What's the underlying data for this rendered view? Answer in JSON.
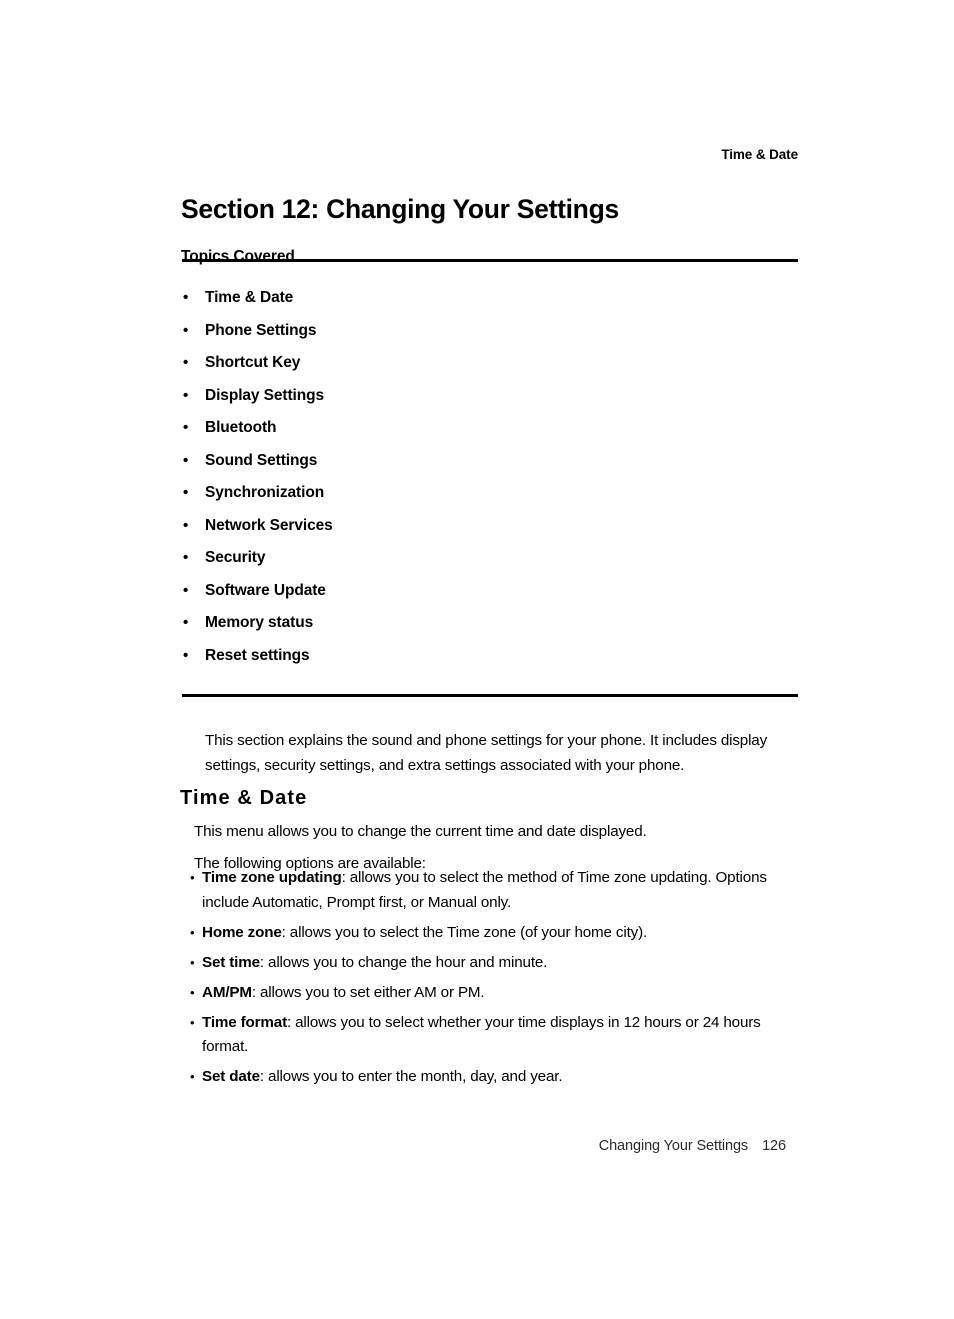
{
  "running_header": "Time & Date",
  "section_title": "Section 12: Changing Your Settings",
  "topics_label": "Topics Covered",
  "bullet_glyph": "•",
  "topics": [
    {
      "label": "Time & Date"
    },
    {
      "label": "Phone Settings"
    },
    {
      "label": "Shortcut Key"
    },
    {
      "label": "Display Settings"
    },
    {
      "label": "Bluetooth"
    },
    {
      "label": "Sound Settings"
    },
    {
      "label": "Synchronization"
    },
    {
      "label": "Network Services"
    },
    {
      "label": "Security"
    },
    {
      "label": "Software Update"
    },
    {
      "label": "Memory status"
    },
    {
      "label": "Reset settings"
    }
  ],
  "intro": "This section explains the sound and phone settings for your phone. It includes display settings, security settings, and extra settings associated with your phone.",
  "sub_heading": "Time & Date",
  "para_1": "This menu allows you to change the current time and date displayed.",
  "para_2": "The following options are available:",
  "options": [
    {
      "term": "Time zone updating",
      "description": ": allows you to select the method of Time zone updating. Options include Automatic, Prompt first, or Manual only."
    },
    {
      "term": "Home zone",
      "description": ": allows you to select the Time zone (of your home city)."
    },
    {
      "term": "Set time",
      "description": ": allows you to change the hour and minute."
    },
    {
      "term": "AM/PM",
      "description": ": allows you to set either AM or PM."
    },
    {
      "term": "Time format",
      "description": ": allows you to select whether your time displays in 12 hours or 24 hours format."
    },
    {
      "term": "Set date",
      "description": ": allows you to enter the month, day, and year."
    }
  ],
  "footer": {
    "title": "Changing Your Settings",
    "page_number": "126"
  },
  "colors": {
    "text": "#000000",
    "footer_text": "#2b2b2b",
    "rule": "#000000",
    "background": "#ffffff"
  }
}
